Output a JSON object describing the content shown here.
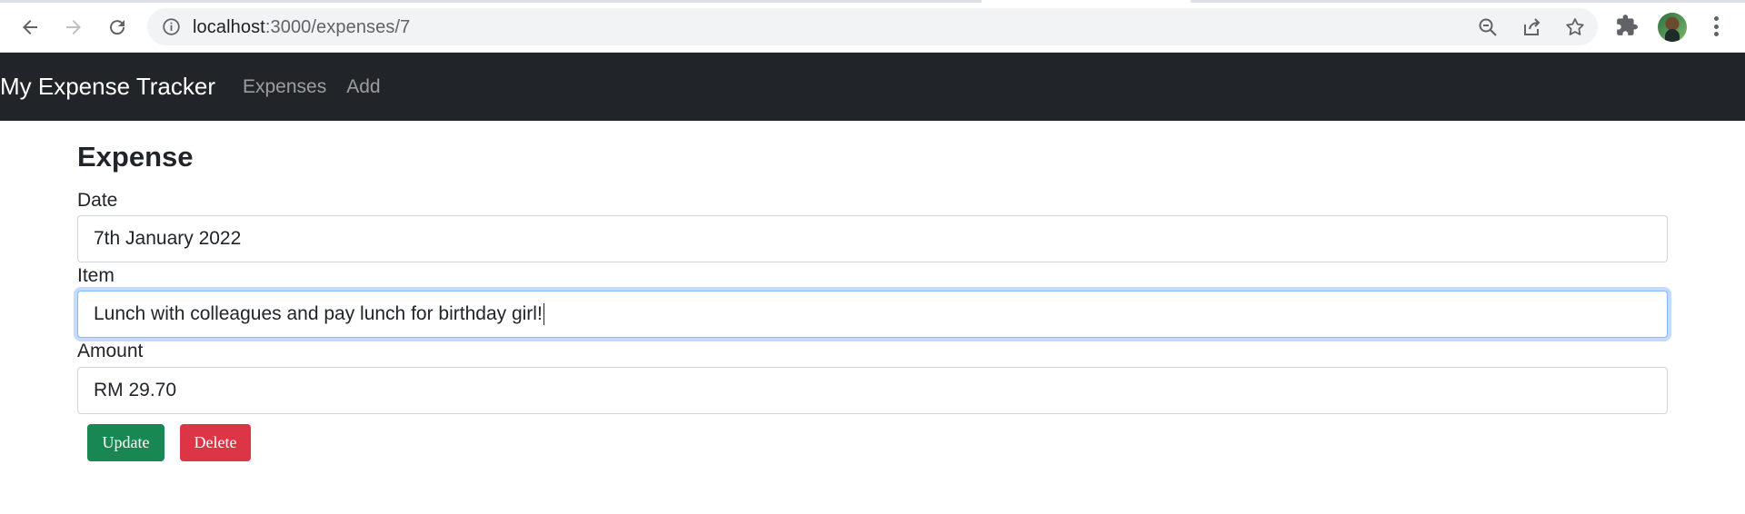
{
  "browser": {
    "url_host": "localhost",
    "url_path": ":3000/expenses/7"
  },
  "navbar": {
    "brand": "My Expense Tracker",
    "links": [
      "Expenses",
      "Add"
    ]
  },
  "form": {
    "title": "Expense",
    "fields": [
      {
        "label": "Date",
        "value": "7th January 2022"
      },
      {
        "label": "Item",
        "value": "Lunch with colleagues and pay lunch for birthday girl!"
      },
      {
        "label": "Amount",
        "value": "RM 29.70"
      }
    ],
    "buttons": {
      "update": "Update",
      "delete": "Delete"
    }
  },
  "colors": {
    "navbar_bg": "#212529",
    "update_button": "#198754",
    "delete_button": "#dc3545",
    "focus_ring": "#86b7fe"
  }
}
